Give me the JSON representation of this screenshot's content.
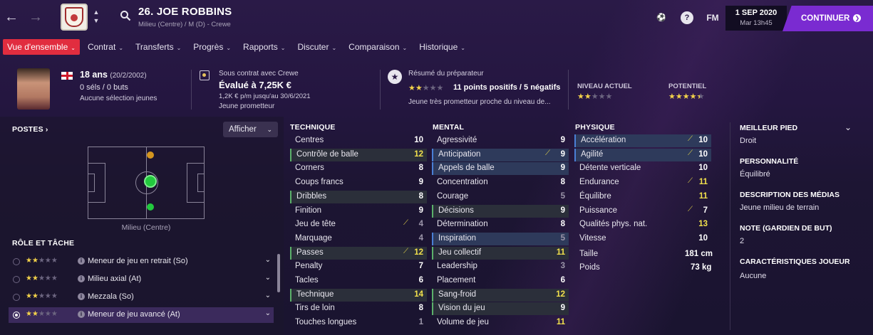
{
  "header": {
    "player_name": "26. JOE ROBBINS",
    "player_sub": "Milieu (Centre) / M (D) - Crewe",
    "icon_fm": "FM",
    "icon_help": "?",
    "date_main": "1 SEP 2020",
    "date_sub": "Mar 13h45",
    "continue_label": "CONTINUER",
    "accent_color": "#7a2bd1"
  },
  "tabs": [
    {
      "label": "Vue d'ensemble",
      "active": true
    },
    {
      "label": "Contrat"
    },
    {
      "label": "Transferts"
    },
    {
      "label": "Progrès"
    },
    {
      "label": "Rapports"
    },
    {
      "label": "Discuter"
    },
    {
      "label": "Comparaison"
    },
    {
      "label": "Historique"
    }
  ],
  "info": {
    "age": "18 ans",
    "dob": "(20/2/2002)",
    "caps": "0 séls / 0 buts",
    "youth": "Aucune sélection jeunes",
    "contract_title": "Sous contrat avec Crewe",
    "value": "Évalué à 7,25K €",
    "wage": "1,2K € p/m jusqu'au 30/6/2021",
    "status": "Jeune prometteur",
    "coach_title": "Résumé du préparateur",
    "coach_stars": 2,
    "coach_points": "11 points positifs / 5 négatifs",
    "coach_desc": "Jeune très prometteur proche du niveau de...",
    "current_label": "NIVEAU ACTUEL",
    "current_stars": 2,
    "potential_label": "POTENTIEL",
    "potential_stars": 4.5
  },
  "positions": {
    "title": "POSTES",
    "afficher": "Afficher",
    "label": "Milieu (Centre)"
  },
  "roles": {
    "title": "RÔLE ET TÂCHE",
    "items": [
      {
        "name": "Meneur de jeu en retrait (So)",
        "stars": 2
      },
      {
        "name": "Milieu axial (At)",
        "stars": 2
      },
      {
        "name": "Mezzala (So)",
        "stars": 2
      },
      {
        "name": "Meneur de jeu avancé (At)",
        "stars": 2,
        "selected": true
      }
    ]
  },
  "technique": {
    "title": "TECHNIQUE",
    "items": [
      {
        "name": "Centres",
        "value": "10"
      },
      {
        "name": "Contrôle de balle",
        "value": "12",
        "hl": "g",
        "gold": true
      },
      {
        "name": "Corners",
        "value": "8"
      },
      {
        "name": "Coups francs",
        "value": "9"
      },
      {
        "name": "Dribbles",
        "value": "8",
        "hl": "g"
      },
      {
        "name": "Finition",
        "value": "9"
      },
      {
        "name": "Jeu de tête",
        "value": "4",
        "dim": true,
        "trend": true
      },
      {
        "name": "Marquage",
        "value": "4",
        "dim": true
      },
      {
        "name": "Passes",
        "value": "12",
        "hl": "g",
        "gold": true,
        "trend": true
      },
      {
        "name": "Penalty",
        "value": "7"
      },
      {
        "name": "Tacles",
        "value": "6"
      },
      {
        "name": "Technique",
        "value": "14",
        "hl": "g",
        "gold": true
      },
      {
        "name": "Tirs de loin",
        "value": "8"
      },
      {
        "name": "Touches longues",
        "value": "1",
        "dim": true
      }
    ]
  },
  "mental": {
    "title": "MENTAL",
    "items": [
      {
        "name": "Agressivité",
        "value": "9"
      },
      {
        "name": "Anticipation",
        "value": "9",
        "hl": "b",
        "trend": true
      },
      {
        "name": "Appels de balle",
        "value": "9",
        "hl": "b"
      },
      {
        "name": "Concentration",
        "value": "8"
      },
      {
        "name": "Courage",
        "value": "5",
        "dim": true
      },
      {
        "name": "Décisions",
        "value": "9",
        "hl": "g"
      },
      {
        "name": "Détermination",
        "value": "8"
      },
      {
        "name": "Inspiration",
        "value": "5",
        "hl": "b",
        "dim": true
      },
      {
        "name": "Jeu collectif",
        "value": "11",
        "hl": "g",
        "gold": true
      },
      {
        "name": "Leadership",
        "value": "3",
        "dim": true
      },
      {
        "name": "Placement",
        "value": "6"
      },
      {
        "name": "Sang-froid",
        "value": "12",
        "hl": "g",
        "gold": true
      },
      {
        "name": "Vision du jeu",
        "value": "9",
        "hl": "g"
      },
      {
        "name": "Volume de jeu",
        "value": "11",
        "gold": true
      }
    ]
  },
  "physique": {
    "title": "PHYSIQUE",
    "items": [
      {
        "name": "Accélération",
        "value": "10",
        "hl": "b",
        "trend": true
      },
      {
        "name": "Agilité",
        "value": "10",
        "hl": "b",
        "trend": true
      },
      {
        "name": "Détente verticale",
        "value": "10"
      },
      {
        "name": "Endurance",
        "value": "11",
        "gold": true,
        "trend": true
      },
      {
        "name": "Équilibre",
        "value": "11",
        "gold": true
      },
      {
        "name": "Puissance",
        "value": "7",
        "trend": true
      },
      {
        "name": "Qualités phys. nat.",
        "value": "13",
        "gold": true
      },
      {
        "name": "Vitesse",
        "value": "10"
      }
    ],
    "height_label": "Taille",
    "height": "181 cm",
    "weight_label": "Poids",
    "weight": "73 kg"
  },
  "side": {
    "foot_title": "MEILLEUR PIED",
    "foot": "Droit",
    "personality_title": "PERSONNALITÉ",
    "personality": "Équilibré",
    "media_title": "DESCRIPTION DES MÉDIAS",
    "media": "Jeune milieu de terrain",
    "gk_title": "NOTE (GARDIEN DE BUT)",
    "gk": "2",
    "traits_title": "CARACTÉRISTIQUES JOUEUR",
    "traits": "Aucune"
  }
}
